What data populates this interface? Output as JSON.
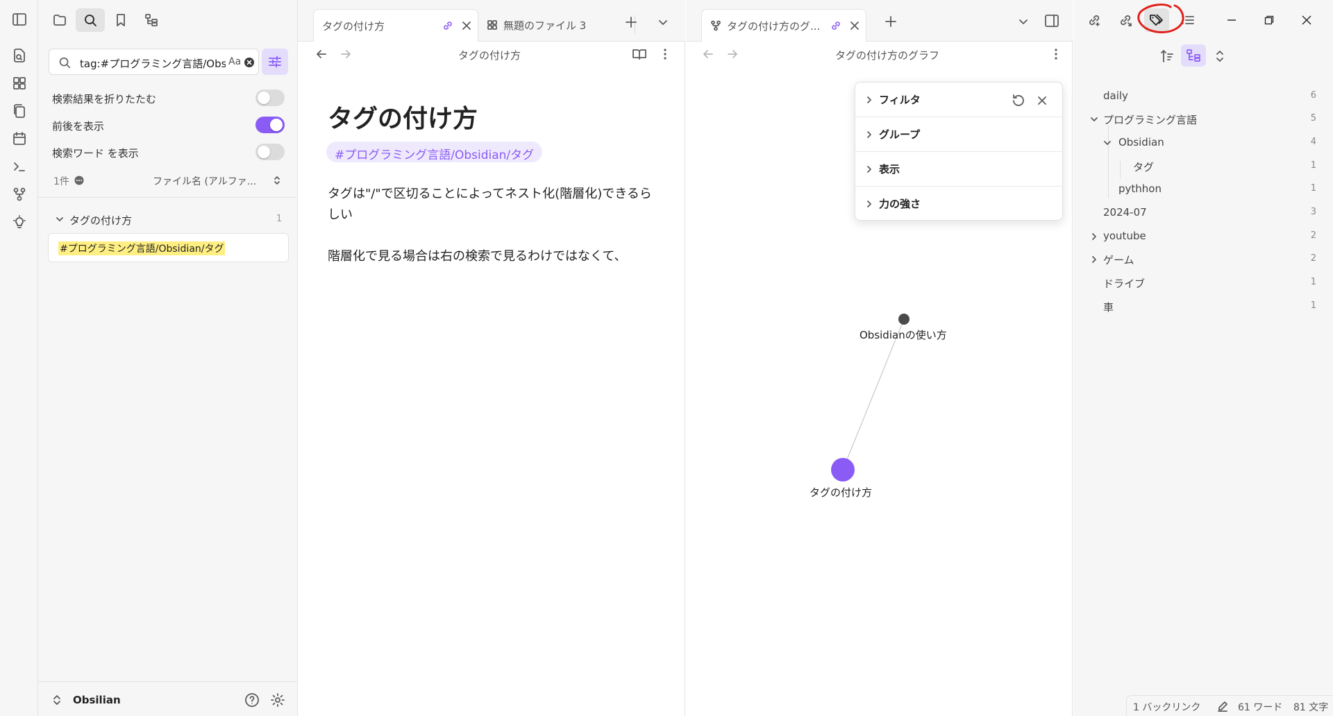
{
  "search": {
    "query": "tag:#プログラミング言語/Obsidian/タグ",
    "placeholder_hint": "Aa",
    "options": [
      {
        "label": "検索結果を折りたたむ",
        "on": false
      },
      {
        "label": "前後を表示",
        "on": true
      },
      {
        "label": "検索ワード を表示",
        "on": false
      }
    ],
    "result_count": "1件",
    "sort_label": "ファイル名 (アルファ...",
    "results": [
      {
        "title": "タグの付け方",
        "count": "1",
        "match": "#プログラミング言語/Obsidian/タグ"
      }
    ]
  },
  "vault": {
    "name": "Obsilian"
  },
  "editor": {
    "tabs": [
      {
        "label": "タグの付け方",
        "active": true
      },
      {
        "label": "無題のファイル 3",
        "active": false
      }
    ],
    "header_title": "タグの付け方",
    "note": {
      "title": "タグの付け方",
      "tag": "#プログラミング言語/Obsidian/タグ",
      "paragraphs": [
        "タグは\"/\"で区切ることによってネスト化(階層化)できるらしい",
        "階層化で見る場合は右の検索で見るわけではなくて、"
      ]
    }
  },
  "graph": {
    "tab_label": "タグの付け方のグ...",
    "header_title": "タグの付け方のグラフ",
    "controls": [
      {
        "label": "フィルタ"
      },
      {
        "label": "グループ"
      },
      {
        "label": "表示"
      },
      {
        "label": "力の強さ"
      }
    ],
    "nodes": [
      {
        "label": "Obsidianの使い方",
        "current": false
      },
      {
        "label": "タグの付け方",
        "current": true
      }
    ],
    "colors": {
      "accent": "#8a5cf5",
      "node": "#4a4a4a",
      "edge": "#c8c8c8"
    }
  },
  "tags_panel": {
    "tags": [
      {
        "name": "daily",
        "count": "6",
        "level": 0,
        "expand": "none"
      },
      {
        "name": "プログラミング言語",
        "count": "5",
        "level": 0,
        "expand": "open"
      },
      {
        "name": "Obsidian",
        "count": "4",
        "level": 1,
        "expand": "open"
      },
      {
        "name": "タグ",
        "count": "1",
        "level": 2,
        "expand": "none"
      },
      {
        "name": "pythhon",
        "count": "1",
        "level": 1,
        "expand": "none"
      },
      {
        "name": "2024-07",
        "count": "3",
        "level": 0,
        "expand": "none"
      },
      {
        "name": "youtube",
        "count": "2",
        "level": 0,
        "expand": "closed"
      },
      {
        "name": "ゲーム",
        "count": "2",
        "level": 0,
        "expand": "closed"
      },
      {
        "name": "ドライブ",
        "count": "1",
        "level": 0,
        "expand": "none"
      },
      {
        "name": "車",
        "count": "1",
        "level": 0,
        "expand": "none"
      }
    ]
  },
  "status_bar": {
    "backlinks": "1 バックリンク",
    "words": "61 ワード",
    "chars": "81 文字"
  },
  "annotation": {
    "color": "#e0201c"
  }
}
